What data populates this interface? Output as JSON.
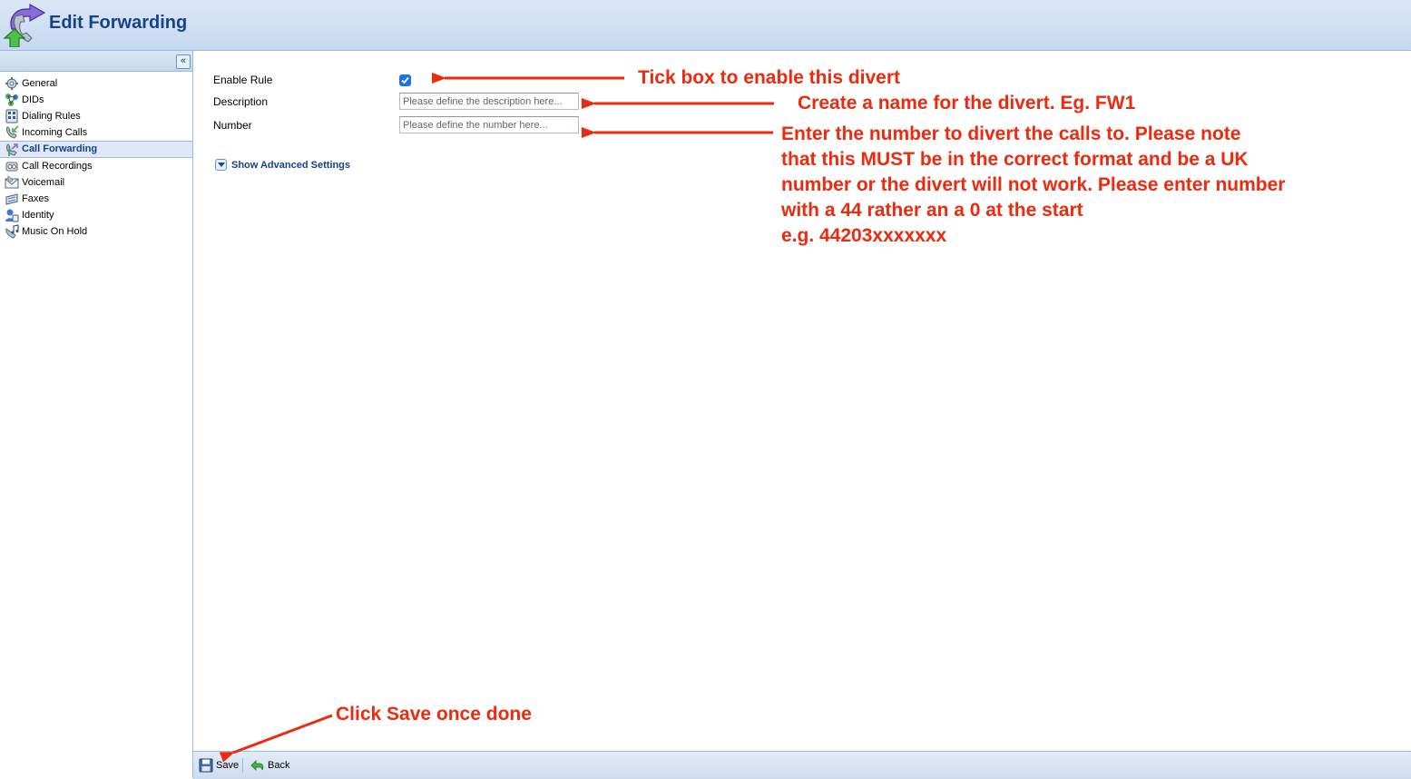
{
  "header": {
    "title": "Edit Forwarding",
    "logo_icon": "forwarding-phone-icon"
  },
  "sidebar": {
    "collapse_icon": "double-chevron-left-icon",
    "items": [
      {
        "label": "General",
        "icon": "gear-icon",
        "active": false
      },
      {
        "label": "DIDs",
        "icon": "network-icon",
        "active": false
      },
      {
        "label": "Dialing Rules",
        "icon": "dialpad-icon",
        "active": false
      },
      {
        "label": "Incoming Calls",
        "icon": "incoming-call-icon",
        "active": false
      },
      {
        "label": "Call Forwarding",
        "icon": "call-forward-icon",
        "active": true
      },
      {
        "label": "Call Recordings",
        "icon": "recording-icon",
        "active": false
      },
      {
        "label": "Voicemail",
        "icon": "voicemail-icon",
        "active": false
      },
      {
        "label": "Faxes",
        "icon": "fax-icon",
        "active": false
      },
      {
        "label": "Identity",
        "icon": "identity-icon",
        "active": false
      },
      {
        "label": "Music On Hold",
        "icon": "music-icon",
        "active": false
      }
    ]
  },
  "form": {
    "enable_rule_label": "Enable Rule",
    "enable_rule_checked": true,
    "description_label": "Description",
    "description_placeholder": "Please define the description here...",
    "description_value": "",
    "number_label": "Number",
    "number_placeholder": "Please define the number here...",
    "number_value": "",
    "advanced_label": "Show Advanced Settings"
  },
  "footer": {
    "save_label": "Save",
    "back_label": "Back"
  },
  "annotations": {
    "color": "#ee2a0e",
    "enable": "Tick box to enable this divert",
    "description": "Create a name for the divert. Eg. FW1",
    "number_lines": [
      "Enter the number to divert the calls to.  Please note",
      "that this MUST be in the correct format and be a UK",
      "number or the divert will not work. Please enter number",
      "with a 44 rather an a 0 at the start",
      "e.g. 44203xxxxxxx"
    ],
    "save": "Click Save once done"
  }
}
